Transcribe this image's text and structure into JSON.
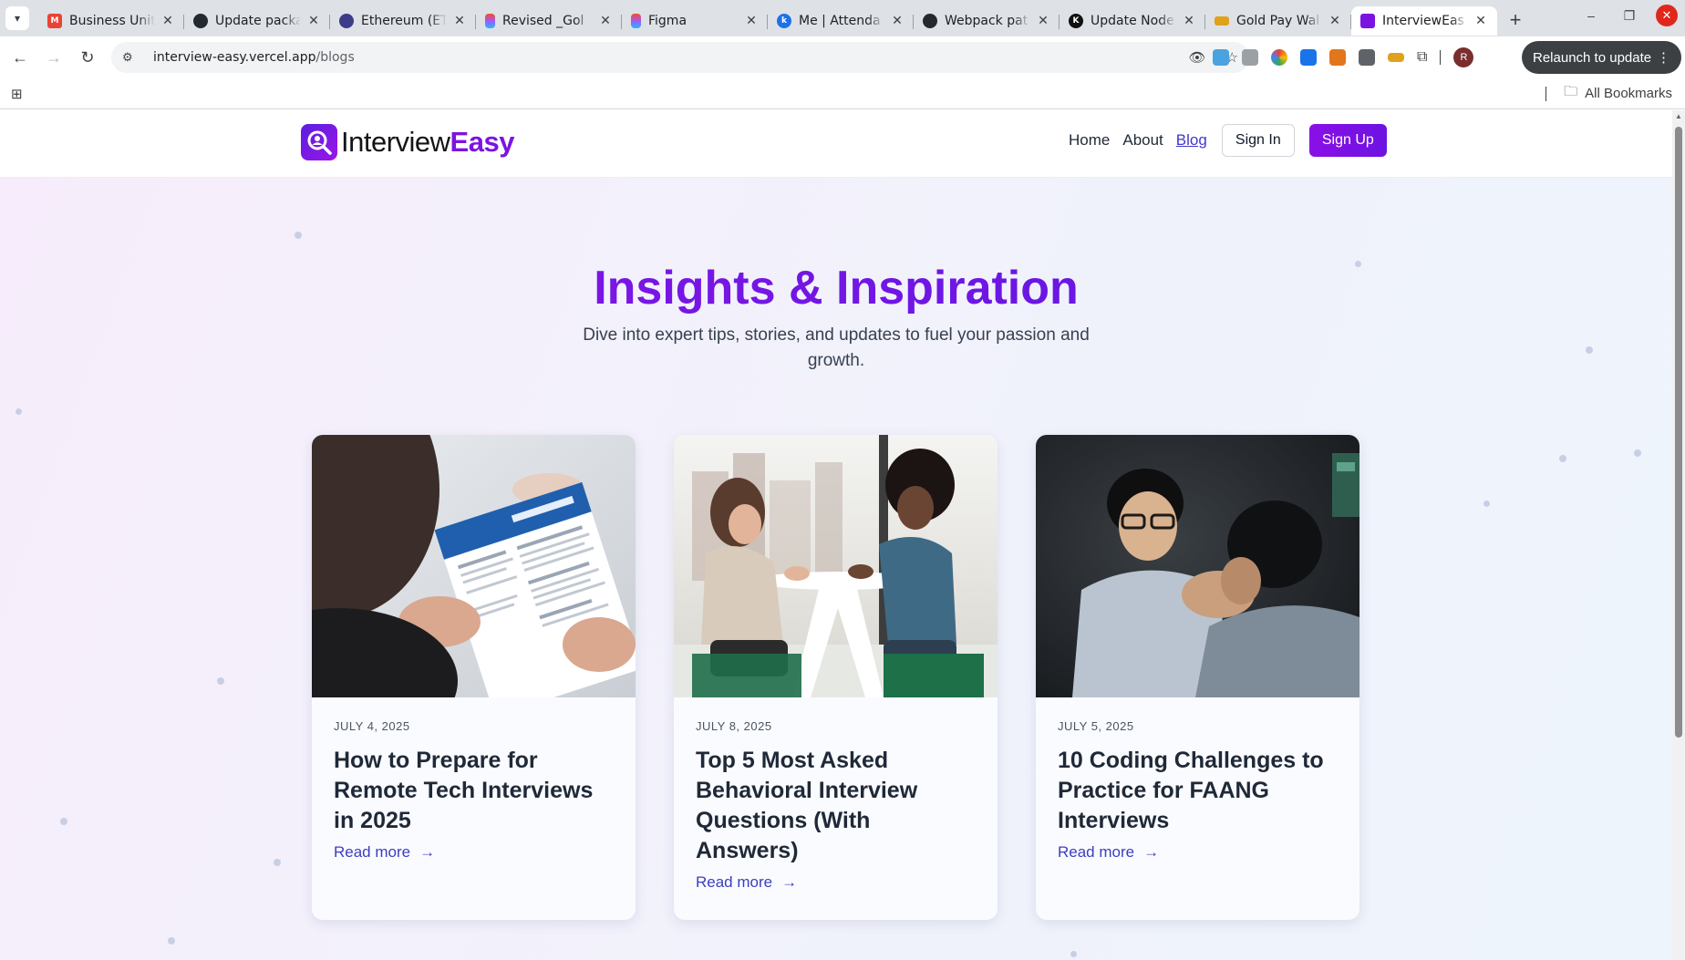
{
  "browser": {
    "tabs": [
      {
        "title": "Business Unit",
        "favicon": "gmail-icon",
        "color": "#ea4335"
      },
      {
        "title": "Update packa",
        "favicon": "github-icon",
        "color": "#24292f"
      },
      {
        "title": "Ethereum (ET",
        "favicon": "ethereum-icon",
        "color": "#3c3c8a"
      },
      {
        "title": "Revised _Gol",
        "favicon": "figma-icon",
        "color": "#a259ff"
      },
      {
        "title": "Figma",
        "favicon": "figma-icon",
        "color": "#a259ff"
      },
      {
        "title": "Me | Attenda",
        "favicon": "k-icon",
        "color": "#1a73e8"
      },
      {
        "title": "Webpack pat",
        "favicon": "github-icon",
        "color": "#24292f"
      },
      {
        "title": "Update Node",
        "favicon": "k-icon",
        "color": "#111111"
      },
      {
        "title": "Gold Pay Wal",
        "favicon": "goldpay-icon",
        "color": "#e0a21a"
      },
      {
        "title": "InterviewEas",
        "favicon": "interviewEasy-icon",
        "color": "#7b14e0",
        "active": true
      }
    ],
    "url_host": "interview-easy.vercel.app",
    "url_path": "/blogs",
    "relaunch_label": "Relaunch to update",
    "bookmarks_label": "All Bookmarks",
    "avatar_letter": "R"
  },
  "site": {
    "logo_plain": "Interview",
    "logo_accent": "Easy",
    "nav": {
      "home": "Home",
      "about": "About",
      "blog": "Blog",
      "sign_in": "Sign In",
      "sign_up": "Sign Up"
    },
    "hero": {
      "title": "Insights & Inspiration",
      "subtitle": "Dive into expert tips, stories, and updates to fuel your passion and growth."
    },
    "posts": [
      {
        "date": "JULY 4, 2025",
        "title": "How to Prepare for Remote Tech Interviews in 2025",
        "cta": "Read more",
        "image": "resume-review-photo"
      },
      {
        "date": "JULY 8, 2025",
        "title": "Top 5 Most Asked Behavioral Interview Questions (With Answers)",
        "cta": "Read more",
        "image": "interview-conversation-photo"
      },
      {
        "date": "JULY 5, 2025",
        "title": "10 Coding Challenges to Practice for FAANG Interviews",
        "cta": "Read more",
        "image": "coding-discussion-photo"
      }
    ],
    "colors": {
      "brand": "#7b14e0",
      "link": "#3b3fc0"
    }
  }
}
